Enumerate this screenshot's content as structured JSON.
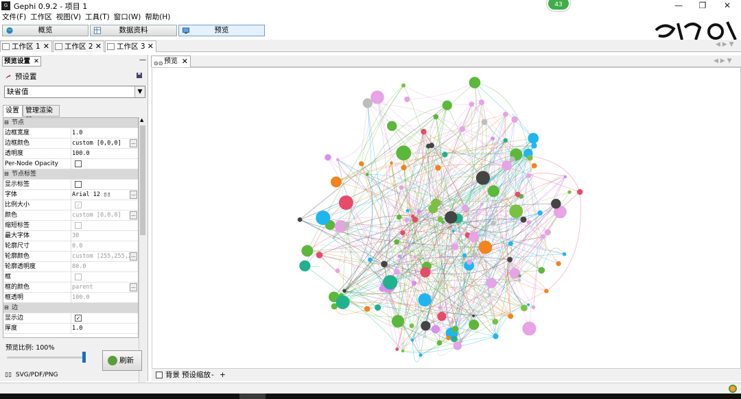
{
  "window": {
    "title": "Gephi 0.9.2 - 项目 1",
    "app_icon_text": "G",
    "notification_badge": "43",
    "buttons": {
      "minimize": "—",
      "restore": "❐",
      "close": "✕"
    }
  },
  "menu": [
    "文件(F)",
    "工作区",
    "视图(V)",
    "工具(T)",
    "窗口(W)",
    "帮助(H)"
  ],
  "modes": [
    {
      "label": "概览",
      "active": false
    },
    {
      "label": "数据资料",
      "active": false
    },
    {
      "label": "预览",
      "active": true
    }
  ],
  "workspace_tabs": [
    {
      "label": "工作区 1",
      "active": false
    },
    {
      "label": "工作区 2",
      "active": false
    },
    {
      "label": "工作区 3",
      "active": true
    }
  ],
  "left_panel": {
    "tab_title": "预览设置",
    "presets_label": "预设置",
    "preset_value": "缺省值",
    "subtabs": [
      "设置",
      "管理渲染器"
    ],
    "rows": [
      {
        "type": "cat",
        "name": "节点"
      },
      {
        "type": "text",
        "name": "边框宽度",
        "value": "1.0"
      },
      {
        "type": "text",
        "name": "边框颜色",
        "value": "custom [0,0,0]",
        "more": true
      },
      {
        "type": "text",
        "name": "透明度",
        "value": "100.0"
      },
      {
        "type": "check",
        "name": "Per-Node Opacity",
        "checked": false
      },
      {
        "type": "cat",
        "name": "节点标签"
      },
      {
        "type": "check",
        "name": "显示标签",
        "checked": false
      },
      {
        "type": "text",
        "name": "字体",
        "value": "Arial 12 ▯▯",
        "more": true
      },
      {
        "type": "check",
        "name": "比例大小",
        "checked": true,
        "disabled": true
      },
      {
        "type": "text",
        "name": "颜色",
        "value": "custom [0,0,0]",
        "more": true,
        "disabled": true
      },
      {
        "type": "check",
        "name": "缩短标签",
        "checked": false,
        "disabled": true
      },
      {
        "type": "text",
        "name": "最大字体",
        "value": "30",
        "disabled": true
      },
      {
        "type": "text",
        "name": "轮廓尺寸",
        "value": "0.0",
        "disabled": true
      },
      {
        "type": "text",
        "name": "轮廓颜色",
        "value": "custom [255,255,255]",
        "more": true,
        "disabled": true
      },
      {
        "type": "text",
        "name": "轮廓透明度",
        "value": "80.0",
        "disabled": true
      },
      {
        "type": "check",
        "name": "框",
        "checked": false,
        "disabled": true
      },
      {
        "type": "text",
        "name": "框的颜色",
        "value": "parent",
        "more": true,
        "disabled": true
      },
      {
        "type": "text",
        "name": "框透明",
        "value": "100.0",
        "disabled": true
      },
      {
        "type": "cat",
        "name": "边"
      },
      {
        "type": "check",
        "name": "显示边",
        "checked": true
      },
      {
        "type": "text",
        "name": "厚度",
        "value": "1.0"
      }
    ],
    "ratio_label": "预览比例:  100%",
    "slider_value_percent": 100,
    "refresh_label": "刷新",
    "export_label": "SVG/PDF/PNG",
    "export_icons": "▯▯"
  },
  "preview": {
    "tab_label": "预览",
    "footer": {
      "background_label": "背景",
      "zoom_label": "预设缩放",
      "zoom_out": "-",
      "zoom_in": "+"
    }
  },
  "colors": {
    "pink": "#e6a3e6",
    "violet": "#d98ef0",
    "green": "#7ac142",
    "darkgreen": "#5cb83a",
    "teal": "#20b28d",
    "cyan": "#1fb6f0",
    "red": "#e84a6a",
    "orange": "#f2841e",
    "gray": "#bdbdbd",
    "dark": "#444444",
    "active_mode": "#e4f0fb"
  }
}
